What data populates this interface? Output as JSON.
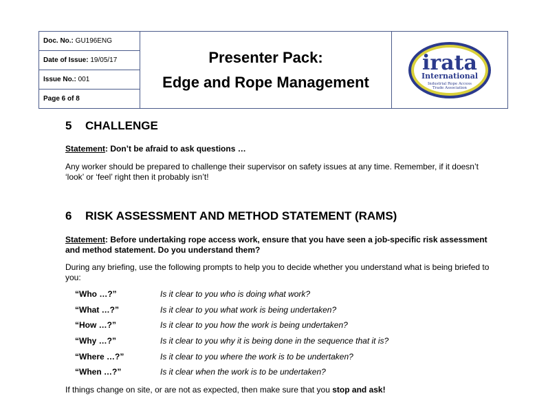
{
  "header": {
    "doc_no_label": "Doc. No.:",
    "doc_no_value": " GU196ENG",
    "date_label": "Date of Issue:",
    "date_value": " 19/05/17",
    "issue_label": "Issue No.:",
    "issue_value": " 001",
    "page_text": "Page 6 of 8",
    "title_line1": "Presenter Pack:",
    "title_line2": "Edge and Rope Management",
    "logo": {
      "name": "irata",
      "sub": "International",
      "tag1": "Industrial Rope Access",
      "tag2": "Trade Association",
      "primary_color": "#2b3a8c",
      "accent_color": "#d9d03a"
    }
  },
  "sections": [
    {
      "number": "5",
      "title": "CHALLENGE",
      "statement_label": "Statement",
      "statement_text": ": Don’t be afraid to ask questions …",
      "body": "Any worker should be prepared to challenge their supervisor on safety issues at any time. Remember, if it doesn’t ‘look’ or ‘feel’ right then it probably isn’t!"
    },
    {
      "number": "6",
      "title": "RISK ASSESSMENT AND METHOD STATEMENT (RAMS)",
      "statement_label": "Statement",
      "statement_text": ": Before undertaking rope access work, ensure that you have seen a job-specific risk assessment and method statement.  Do you understand them?",
      "intro": "During any briefing, use the following prompts to help you to decide whether you understand what is being briefed to you:",
      "prompts": [
        {
          "key": "“Who …?”",
          "question": "Is it clear to you who is doing what work?"
        },
        {
          "key": "“What …?”",
          "question": "Is it clear to you what work is being undertaken?"
        },
        {
          "key": "“How …?”",
          "question": "Is it clear to you how the work is being undertaken?"
        },
        {
          "key": "“Why …?”",
          "question": "Is it clear to you why it is being done in the sequence that it is?"
        },
        {
          "key": "“Where …?”",
          "question": "Is it clear to you where the work is to be undertaken?"
        },
        {
          "key": "“When …?”",
          "question": "Is it clear when the work is to be undertaken?"
        }
      ],
      "closing_text": "If things change on site, or are not as expected, then make sure that you ",
      "closing_bold": "stop and ask!"
    }
  ]
}
